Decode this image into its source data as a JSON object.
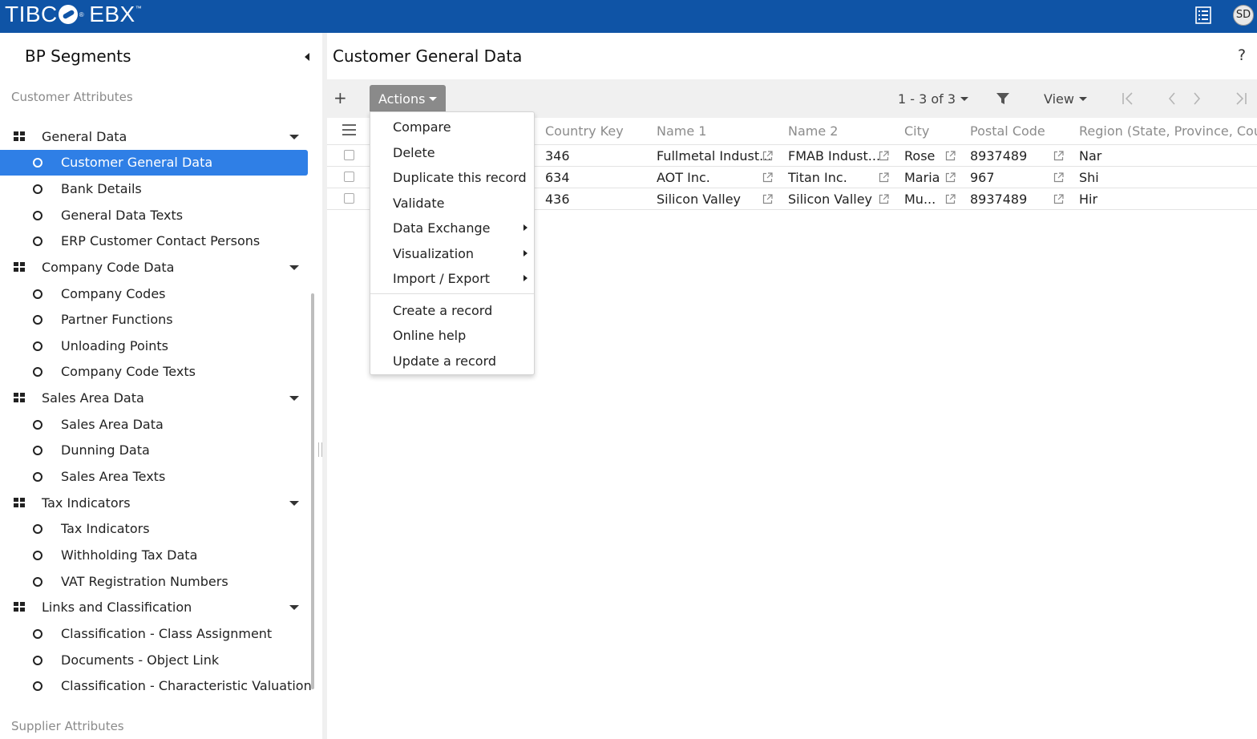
{
  "app": {
    "logo_text": "TIBC",
    "logo_text2": "EBX",
    "logo_reg": "®",
    "logo_tm": "™",
    "avatar_initials": "SD"
  },
  "sidebar": {
    "title": "BP Segments",
    "section_top": "Customer Attributes",
    "section_bottom": "Supplier Attributes",
    "groups": [
      {
        "label": "General Data",
        "items": [
          "Customer General Data",
          "Bank Details",
          "General Data Texts",
          "ERP Customer Contact Persons"
        ]
      },
      {
        "label": "Company Code Data",
        "items": [
          "Company Codes",
          "Partner Functions",
          "Unloading Points",
          "Company Code Texts"
        ]
      },
      {
        "label": "Sales Area Data",
        "items": [
          "Sales Area Data",
          "Dunning Data",
          "Sales Area Texts"
        ]
      },
      {
        "label": "Tax Indicators",
        "items": [
          "Tax Indicators",
          "Withholding Tax Data",
          "VAT Registration Numbers"
        ]
      },
      {
        "label": "Links and Classification",
        "items": [
          "Classification - Class Assignment",
          "Documents - Object Link",
          "Classification - Characteristic Valuation"
        ]
      }
    ],
    "selected_item": "Customer General Data"
  },
  "main": {
    "title": "Customer General Data",
    "help": "?",
    "toolbar": {
      "add": "+",
      "actions_label": "Actions",
      "pager": "1 - 3 of 3",
      "view_label": "View"
    },
    "table": {
      "columns": [
        "Country Key",
        "Name 1",
        "Name 2",
        "City",
        "Postal Code",
        "Region (State, Province, County)"
      ],
      "rows": [
        [
          "346",
          "Fullmetal Indust...",
          "FMAB Indust...",
          "Rose",
          "8937489",
          "Nar"
        ],
        [
          "634",
          "AOT Inc.",
          "Titan Inc.",
          "Maria",
          "967",
          "Shi"
        ],
        [
          "436",
          "Silicon Valley",
          "Silicon Valley",
          "Mu...",
          "8937489",
          "Hir"
        ]
      ]
    },
    "actions_menu": {
      "items": [
        "Compare",
        "Delete",
        "Duplicate this record",
        "Validate",
        "Data Exchange",
        "Visualization",
        "Import / Export",
        "Create a record",
        "Online help",
        "Update a record"
      ]
    }
  },
  "colors": {
    "topbar": "#0f54a6",
    "selected": "#2f7fe6",
    "actions_button": "#8a8a8a"
  }
}
